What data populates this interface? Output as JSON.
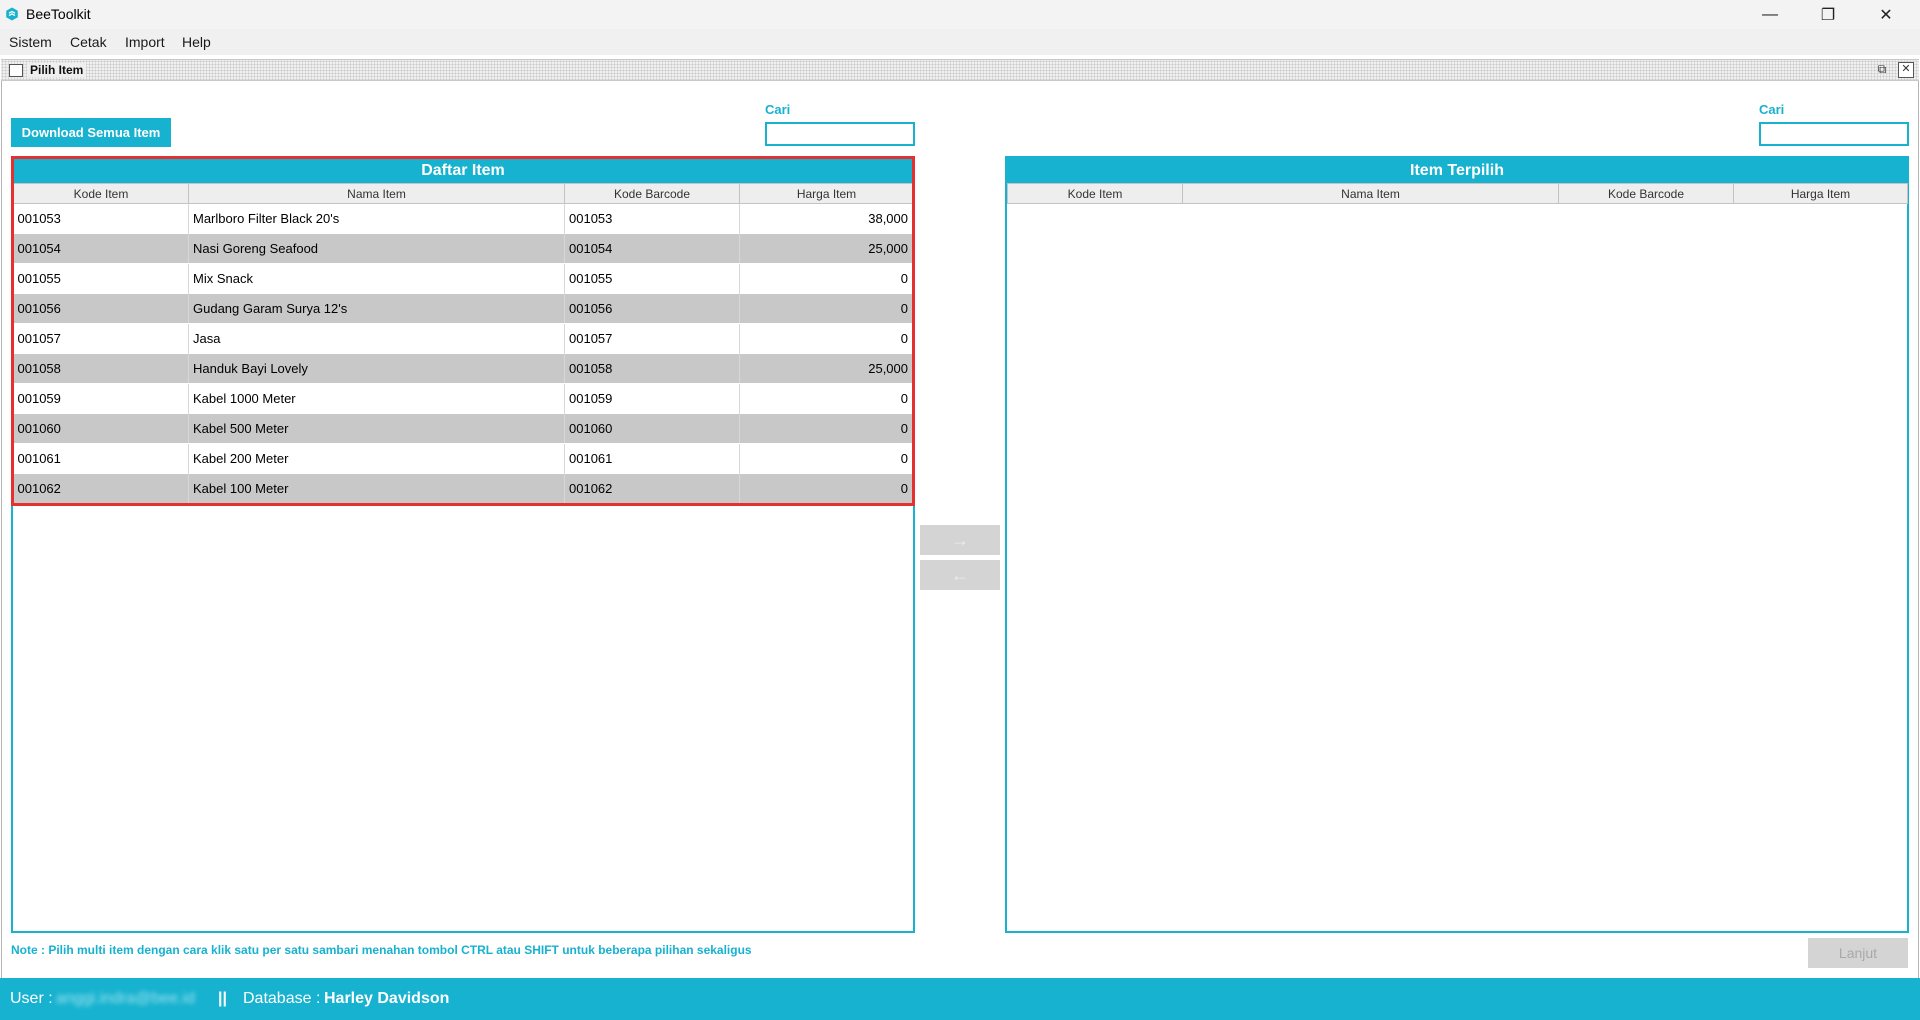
{
  "window": {
    "app_title": "BeeToolkit",
    "icons": {
      "app": "bee-logo-icon",
      "minimize": "minimize-icon",
      "maximize": "restore-icon",
      "close": "close-icon"
    },
    "minimize_glyph": "—",
    "maximize_glyph": "❐",
    "close_glyph": "✕"
  },
  "menu": [
    "Sistem",
    "Cetak",
    "Import",
    "Help"
  ],
  "frame": {
    "title": "Pilih Item",
    "restore_glyph": "⧉",
    "close_glyph": "✕"
  },
  "toolbar": {
    "download_label": "Download Semua Item",
    "search_left_label": "Cari",
    "search_left_value": "",
    "search_right_label": "Cari",
    "search_right_value": ""
  },
  "left_panel": {
    "title": "Daftar Item",
    "columns": [
      "Kode Item",
      "Nama Item",
      "Kode Barcode",
      "Harga Item"
    ],
    "rows": [
      [
        "001053",
        "Marlboro Filter Black 20's",
        "001053",
        "38,000"
      ],
      [
        "001054",
        "Nasi Goreng Seafood",
        "001054",
        "25,000"
      ],
      [
        "001055",
        "Mix Snack",
        "001055",
        "0"
      ],
      [
        "001056",
        "Gudang Garam Surya 12's",
        "001056",
        "0"
      ],
      [
        "001057",
        "Jasa",
        "001057",
        "0"
      ],
      [
        "001058",
        "Handuk Bayi Lovely",
        "001058",
        "25,000"
      ],
      [
        "001059",
        "Kabel 1000 Meter",
        "001059",
        "0"
      ],
      [
        "001060",
        "Kabel 500 Meter",
        "001060",
        "0"
      ],
      [
        "001061",
        "Kabel 200 Meter",
        "001061",
        "0"
      ],
      [
        "001062",
        "Kabel 100 Meter",
        "001062",
        "0"
      ]
    ]
  },
  "right_panel": {
    "title": "Item Terpilih",
    "columns": [
      "Kode Item",
      "Nama Item",
      "Kode Barcode",
      "Harga Item"
    ],
    "rows": []
  },
  "transfer": {
    "add_glyph": "→",
    "remove_glyph": "←",
    "icons": [
      "arrow-right-icon",
      "arrow-left-icon"
    ]
  },
  "note": "Note : Pilih multi item dengan cara klik satu per satu sambari menahan tombol CTRL atau SHIFT untuk beberapa pilihan sekaligus",
  "lanjut_label": "Lanjut",
  "status": {
    "user_label": "User :",
    "user_value": "anggi.indra@bee.id",
    "separator": "||",
    "db_label": "Database :",
    "db_value": "Harley Davidson"
  },
  "colors": {
    "accent": "#17b2cf",
    "highlight": "#e53030",
    "row_alt": "#c8c8c8",
    "disabled": "#d4d4d4"
  }
}
